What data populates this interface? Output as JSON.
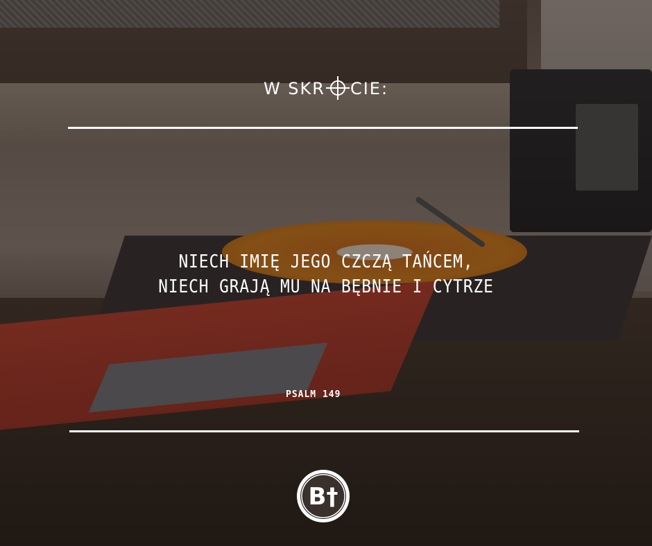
{
  "heading": {
    "before": "W SKR",
    "after": "CIE:",
    "crosshair_icon": "crosshair-icon"
  },
  "verse": {
    "line1": "NIECH IMIĘ JEGO CZCZĄ TAŃCEM,",
    "line2": "NIECH GRAJĄ MU NA BĘBNIE I CYTRZE"
  },
  "source": "PSALM 149",
  "logo": {
    "text": "B†",
    "icon": "brand-logo-icon"
  },
  "colors": {
    "text": "#ffffff",
    "record_orange": "#e0841c",
    "album_red": "#c4402e"
  }
}
